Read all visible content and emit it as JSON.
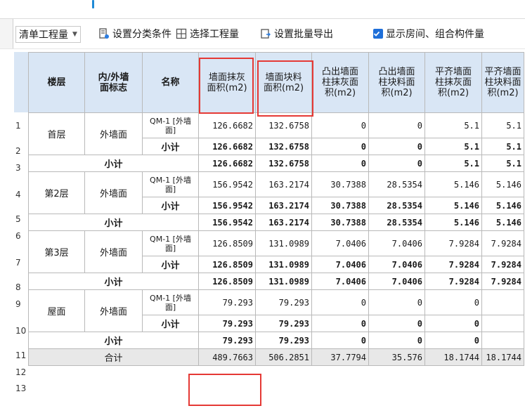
{
  "toolbar": {
    "dropdown_value": "清单工程量",
    "set_category_label": "设置分类条件",
    "select_project_label": "选择工程量",
    "batch_export_label": "设置批量导出",
    "show_rooms_label": "显示房间、组合构件量",
    "show_rooms_checked": true
  },
  "table": {
    "headers": {
      "floor": "楼层",
      "inout": "内/外墙\n面标志",
      "name": "名称",
      "wall_plaster": "墙面抹灰\n面积(m2)",
      "wall_block": "墙面块料\n面积(m2)",
      "conv_col_plaster": "凸出墙面\n柱抹灰面\n积(m2)",
      "conv_col_block": "凸出墙面\n柱块料面\n积(m2)",
      "flush_col_plaster": "平齐墙面\n柱抹灰面\n积(m2)",
      "flush_col_block": "平齐墙面\n柱块料面\n积(m2)"
    },
    "row_numbers": [
      "1",
      "2",
      "3",
      "4",
      "5",
      "6",
      "7",
      "8",
      "9",
      "10",
      "11",
      "12",
      "13"
    ],
    "groups": [
      {
        "floor": "首层",
        "inout": "外墙面",
        "item_name": "QM-1 [外墙面]",
        "item_values": [
          "126.6682",
          "132.6758",
          "0",
          "0",
          "5.1",
          "5.1"
        ],
        "subtotal_label": "小计",
        "subtotal_values": [
          "126.6682",
          "132.6758",
          "0",
          "0",
          "5.1",
          "5.1"
        ],
        "floor_subtotal_label": "小计",
        "floor_subtotal_values": [
          "126.6682",
          "132.6758",
          "0",
          "0",
          "5.1",
          "5.1"
        ]
      },
      {
        "floor": "第2层",
        "inout": "外墙面",
        "item_name": "QM-1 [外墙面]",
        "item_values": [
          "156.9542",
          "163.2174",
          "30.7388",
          "28.5354",
          "5.146",
          "5.146"
        ],
        "subtotal_label": "小计",
        "subtotal_values": [
          "156.9542",
          "163.2174",
          "30.7388",
          "28.5354",
          "5.146",
          "5.146"
        ],
        "floor_subtotal_label": "小计",
        "floor_subtotal_values": [
          "156.9542",
          "163.2174",
          "30.7388",
          "28.5354",
          "5.146",
          "5.146"
        ]
      },
      {
        "floor": "第3层",
        "inout": "外墙面",
        "item_name": "QM-1 [外墙面]",
        "item_values": [
          "126.8509",
          "131.0989",
          "7.0406",
          "7.0406",
          "7.9284",
          "7.9284"
        ],
        "subtotal_label": "小计",
        "subtotal_values": [
          "126.8509",
          "131.0989",
          "7.0406",
          "7.0406",
          "7.9284",
          "7.9284"
        ],
        "floor_subtotal_label": "小计",
        "floor_subtotal_values": [
          "126.8509",
          "131.0989",
          "7.0406",
          "7.0406",
          "7.9284",
          "7.9284"
        ]
      },
      {
        "floor": "屋面",
        "inout": "外墙面",
        "item_name": "QM-1 [外墙面]",
        "item_values": [
          "79.293",
          "79.293",
          "0",
          "0",
          "0",
          ""
        ],
        "subtotal_label": "小计",
        "subtotal_values": [
          "79.293",
          "79.293",
          "0",
          "0",
          "0",
          ""
        ],
        "floor_subtotal_label": "小计",
        "floor_subtotal_values": [
          "79.293",
          "79.293",
          "0",
          "0",
          "0",
          ""
        ]
      }
    ],
    "total_label": "合计",
    "total_values": [
      "489.7663",
      "506.2851",
      "37.7794",
      "35.576",
      "18.1744",
      "18.1744"
    ]
  },
  "colors": {
    "header_bg": "#d9e6f5",
    "total_row_bg": "#e8e8e8",
    "highlight_red": "#e53935",
    "checkbox_blue": "#1e6fd9"
  }
}
